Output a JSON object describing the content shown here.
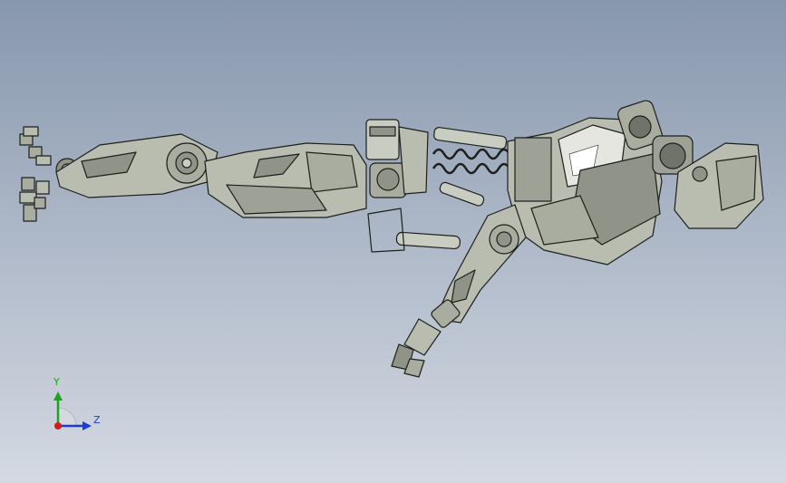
{
  "viewport": {
    "model_name": "robotic-exoskeleton-assembly",
    "background_top": "#8797ad",
    "background_bottom": "#d4d9e2",
    "part_fill": "#b9bdb0",
    "part_shade": "#8f9388",
    "edge_color": "#1c1f1c"
  },
  "triad": {
    "y_label": "Y",
    "z_label": "Z",
    "y_color": "#1aa61a",
    "z_color": "#1e3bd4",
    "x_color": "#d01c1c"
  }
}
